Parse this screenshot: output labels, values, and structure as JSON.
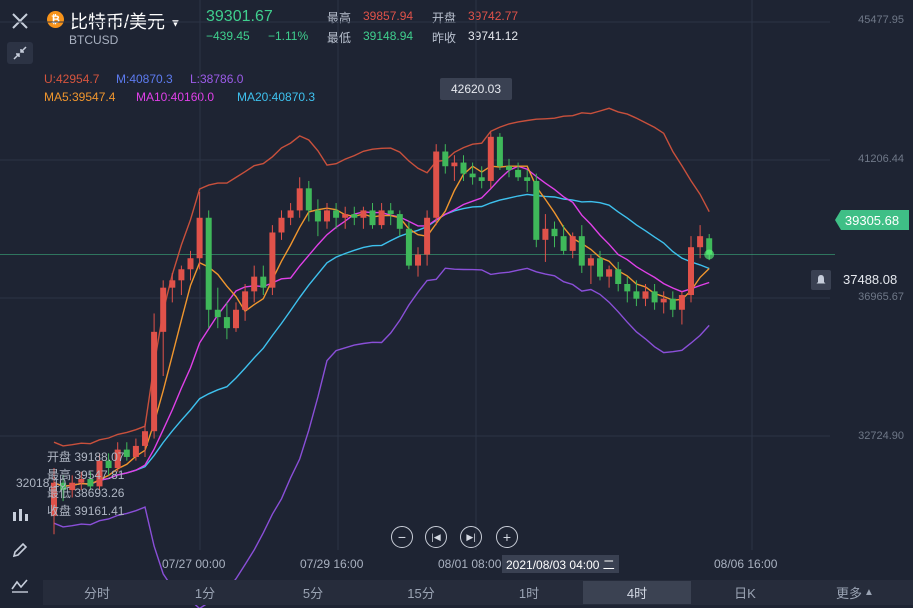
{
  "header": {
    "title": "比特币/美元",
    "symbol": "BTCUSD",
    "price": "39301.67",
    "change": "−439.45",
    "change_pct": "−1.11%",
    "high_label": "最高",
    "high_value": "39857.94",
    "open_label": "开盘",
    "open_value": "39742.77",
    "low_label": "最低",
    "low_value": "39148.94",
    "prev_close_label": "昨收",
    "prev_close_value": "39741.12"
  },
  "indicators": {
    "boll_u": "U:42954.7",
    "boll_m": "M:40870.3",
    "boll_l": "L:38786.0",
    "ma5": "MA5:39547.4",
    "ma10": "MA10:40160.0",
    "ma20": "MA20:40870.3"
  },
  "y_axis": {
    "ticks": [
      "45477.95",
      "41206.44",
      "36965.67",
      "32724.90"
    ],
    "current_price_tag": "39305.68",
    "alert_price": "37488.08",
    "left_marker": "32018.10"
  },
  "x_axis": {
    "ticks": [
      "07/27 00:00",
      "07/29 16:00",
      "08/01 08:00",
      "08/06 16:00"
    ],
    "crosshair_label": "2021/08/03 04:00 二"
  },
  "tooltip_high": "42620.03",
  "ohlc": {
    "open_label": "开盘",
    "open": "39188.07",
    "high_label": "最高",
    "high": "39547.81",
    "low_label": "最低",
    "low": "38693.26",
    "close_label": "收盘",
    "close": "39161.41"
  },
  "tabs": [
    "分时",
    "1分",
    "5分",
    "15分",
    "1时",
    "4时",
    "日K",
    "更多"
  ],
  "active_tab": "4时",
  "colors": {
    "background": "#1e2433",
    "up": "#e0524a",
    "down": "#3fb85a",
    "boll_upper": "#c8503c",
    "boll_lower": "#8a4fd8",
    "ma5": "#f0962e",
    "ma10": "#e040e8",
    "ma20": "#3ec1ee",
    "price_tag": "#3fbf86"
  },
  "chart_data": {
    "type": "candlestick",
    "symbol": "BTCUSD",
    "interval": "4h",
    "y_range": [
      31000,
      46000
    ],
    "candles": [
      {
        "o": 32200,
        "h": 33500,
        "l": 31700,
        "c": 33100
      },
      {
        "o": 33100,
        "h": 33300,
        "l": 32600,
        "c": 32900
      },
      {
        "o": 32900,
        "h": 33300,
        "l": 32700,
        "c": 33100
      },
      {
        "o": 33100,
        "h": 33400,
        "l": 32900,
        "c": 33200
      },
      {
        "o": 33200,
        "h": 33400,
        "l": 32900,
        "c": 33000
      },
      {
        "o": 33000,
        "h": 33900,
        "l": 32900,
        "c": 33700
      },
      {
        "o": 33700,
        "h": 33900,
        "l": 33300,
        "c": 33500
      },
      {
        "o": 33500,
        "h": 34200,
        "l": 33400,
        "c": 34000
      },
      {
        "o": 34000,
        "h": 34200,
        "l": 33700,
        "c": 33800
      },
      {
        "o": 33800,
        "h": 34300,
        "l": 33700,
        "c": 34100
      },
      {
        "o": 34100,
        "h": 34700,
        "l": 33800,
        "c": 34500
      },
      {
        "o": 34500,
        "h": 37700,
        "l": 34300,
        "c": 37200
      },
      {
        "o": 37200,
        "h": 38600,
        "l": 36000,
        "c": 38400
      },
      {
        "o": 38400,
        "h": 38800,
        "l": 38000,
        "c": 38600
      },
      {
        "o": 38600,
        "h": 39000,
        "l": 38200,
        "c": 38900
      },
      {
        "o": 38900,
        "h": 39400,
        "l": 38600,
        "c": 39200
      },
      {
        "o": 39200,
        "h": 41000,
        "l": 38900,
        "c": 40300
      },
      {
        "o": 40300,
        "h": 40500,
        "l": 37300,
        "c": 37800
      },
      {
        "o": 37800,
        "h": 38400,
        "l": 37300,
        "c": 37600
      },
      {
        "o": 37600,
        "h": 38000,
        "l": 37000,
        "c": 37300
      },
      {
        "o": 37300,
        "h": 38000,
        "l": 37200,
        "c": 37800
      },
      {
        "o": 37800,
        "h": 38500,
        "l": 37500,
        "c": 38300
      },
      {
        "o": 38300,
        "h": 39000,
        "l": 38000,
        "c": 38700
      },
      {
        "o": 38700,
        "h": 39000,
        "l": 38200,
        "c": 38400
      },
      {
        "o": 38400,
        "h": 40100,
        "l": 38200,
        "c": 39900
      },
      {
        "o": 39900,
        "h": 40500,
        "l": 39700,
        "c": 40300
      },
      {
        "o": 40300,
        "h": 40700,
        "l": 40100,
        "c": 40500
      },
      {
        "o": 40500,
        "h": 41400,
        "l": 40300,
        "c": 41100
      },
      {
        "o": 41100,
        "h": 41300,
        "l": 40200,
        "c": 40500
      },
      {
        "o": 40500,
        "h": 40800,
        "l": 39800,
        "c": 40200
      },
      {
        "o": 40200,
        "h": 40700,
        "l": 40000,
        "c": 40500
      },
      {
        "o": 40500,
        "h": 40700,
        "l": 40000,
        "c": 40300
      },
      {
        "o": 40300,
        "h": 40600,
        "l": 40000,
        "c": 40400
      },
      {
        "o": 40400,
        "h": 40600,
        "l": 40100,
        "c": 40300
      },
      {
        "o": 40300,
        "h": 40600,
        "l": 40000,
        "c": 40500
      },
      {
        "o": 40500,
        "h": 40700,
        "l": 40000,
        "c": 40100
      },
      {
        "o": 40100,
        "h": 40700,
        "l": 40000,
        "c": 40500
      },
      {
        "o": 40500,
        "h": 40700,
        "l": 40100,
        "c": 40400
      },
      {
        "o": 40400,
        "h": 40500,
        "l": 39800,
        "c": 40000
      },
      {
        "o": 40000,
        "h": 40200,
        "l": 38900,
        "c": 39000
      },
      {
        "o": 39000,
        "h": 39500,
        "l": 38700,
        "c": 39300
      },
      {
        "o": 39300,
        "h": 40500,
        "l": 39000,
        "c": 40300
      },
      {
        "o": 40300,
        "h": 42300,
        "l": 40100,
        "c": 42100
      },
      {
        "o": 42100,
        "h": 42300,
        "l": 41500,
        "c": 41700
      },
      {
        "o": 41700,
        "h": 42000,
        "l": 41300,
        "c": 41800
      },
      {
        "o": 41800,
        "h": 42000,
        "l": 41300,
        "c": 41500
      },
      {
        "o": 41500,
        "h": 41800,
        "l": 41200,
        "c": 41400
      },
      {
        "o": 41400,
        "h": 41700,
        "l": 41100,
        "c": 41300
      },
      {
        "o": 41300,
        "h": 42620.03,
        "l": 41100,
        "c": 42500
      },
      {
        "o": 42500,
        "h": 42600,
        "l": 41600,
        "c": 41700
      },
      {
        "o": 41700,
        "h": 41900,
        "l": 41400,
        "c": 41600
      },
      {
        "o": 41600,
        "h": 41800,
        "l": 41300,
        "c": 41400
      },
      {
        "o": 41400,
        "h": 41600,
        "l": 41000,
        "c": 41300
      },
      {
        "o": 41300,
        "h": 41500,
        "l": 39500,
        "c": 39700
      },
      {
        "o": 39700,
        "h": 40400,
        "l": 39100,
        "c": 40000
      },
      {
        "o": 40000,
        "h": 40200,
        "l": 39500,
        "c": 39800
      },
      {
        "o": 39800,
        "h": 40100,
        "l": 39300,
        "c": 39400
      },
      {
        "o": 39400,
        "h": 39900,
        "l": 39200,
        "c": 39800
      },
      {
        "o": 39800,
        "h": 40100,
        "l": 38800,
        "c": 39000
      },
      {
        "o": 39000,
        "h": 39300,
        "l": 38500,
        "c": 39200
      },
      {
        "o": 39200,
        "h": 39400,
        "l": 38600,
        "c": 38700
      },
      {
        "o": 38700,
        "h": 39000,
        "l": 38400,
        "c": 38900
      },
      {
        "o": 38900,
        "h": 39100,
        "l": 38300,
        "c": 38500
      },
      {
        "o": 38500,
        "h": 38700,
        "l": 38000,
        "c": 38300
      },
      {
        "o": 38300,
        "h": 38600,
        "l": 37900,
        "c": 38100
      },
      {
        "o": 38100,
        "h": 38500,
        "l": 37900,
        "c": 38300
      },
      {
        "o": 38300,
        "h": 38500,
        "l": 37800,
        "c": 38000
      },
      {
        "o": 38000,
        "h": 38300,
        "l": 37700,
        "c": 38100
      },
      {
        "o": 38100,
        "h": 38300,
        "l": 37600,
        "c": 37800
      },
      {
        "o": 37800,
        "h": 38300,
        "l": 37400,
        "c": 38200
      },
      {
        "o": 38200,
        "h": 39800,
        "l": 38000,
        "c": 39500
      },
      {
        "o": 39500,
        "h": 40100,
        "l": 39200,
        "c": 39800
      },
      {
        "o": 39742.77,
        "h": 39857.94,
        "l": 39148.94,
        "c": 39301.67
      }
    ]
  }
}
